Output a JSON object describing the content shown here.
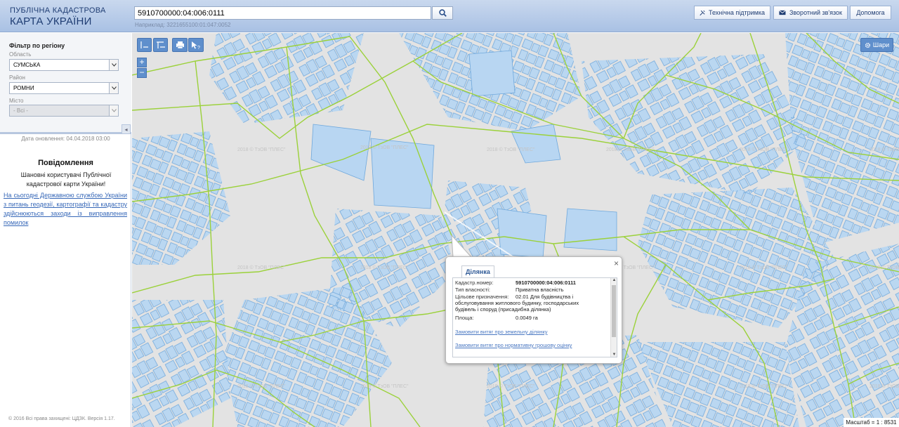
{
  "header": {
    "logo_line1": "ПУБЛІЧНА КАДАСТРОВА",
    "logo_line2": "КАРТА УКРАЇНИ",
    "search_value": "5910700000:04:006:0111",
    "search_hint": "Наприклад: 3221655100:01:047:0052",
    "buttons": {
      "support": "Технічна підтримка",
      "feedback": "Зворотний зв'язок",
      "help": "Допомога"
    },
    "icons": {
      "search": "search-icon",
      "support": "tools-icon",
      "feedback": "envelope-icon"
    }
  },
  "sidebar": {
    "filter_title": "Фільтр по регіону",
    "oblast_label": "Область",
    "oblast_value": "СУМСЬКА",
    "raion_label": "Район",
    "raion_value": "РОМНИ",
    "misto_label": "Місто",
    "misto_value": "- Всі -",
    "update_date": "Дата оновлення: 04.04.2018 03:00",
    "notice_title": "Повідомлення",
    "notice_body": "Шановні користувачі Публічної кадастрової карти України!",
    "notice_link": "На сьогодні Державною службою України з питань геодезії, картографії та кадастру здійснюються заходи із виправлення помилок",
    "copyright": "© 2016 Всі права захищені: ЦДЗК. Версія 1.17."
  },
  "map": {
    "tools": [
      "measure-length-icon",
      "measure-area-icon",
      "print-icon",
      "identify-icon"
    ],
    "zoom_in": "+",
    "zoom_out": "−",
    "layers_label": "Шари",
    "scale_text": "Масштаб = 1 : 8531",
    "watermark": "2018 © ТзОВ \"ПЛЕС\"",
    "colors": {
      "parcel_fill": "#b8d6f2",
      "parcel_stroke": "#6fa8dc",
      "boundary": "#9bd13a",
      "map_bg": "#e3e3e3"
    }
  },
  "popup": {
    "tab_label": "Ділянка",
    "rows": [
      {
        "key": "Кадастр.номер:",
        "value": "5910700000:04:006:0111"
      },
      {
        "key": "Тип власності:",
        "value": "Приватна власність"
      },
      {
        "key": "Цільове призначення:",
        "value": "02.01 Для будівництва і обслуговування житлового будинку, господарських будівель і споруд (присадибна ділянка)"
      },
      {
        "key": "Площа:",
        "value": "0.0049 га"
      }
    ],
    "link_extract": "Замовити витяг про земельну ділянку",
    "link_valuation": "Замовити витяг про нормативну грошову оцінку"
  }
}
